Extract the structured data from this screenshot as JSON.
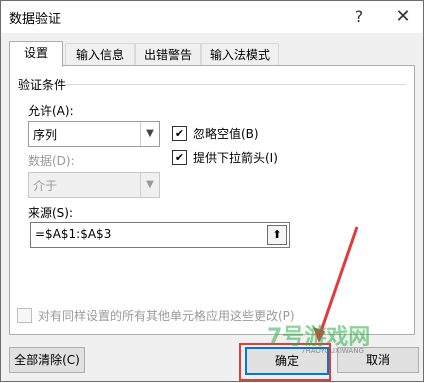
{
  "window": {
    "title": "数据验证",
    "help_label": "?",
    "close_label": "✕"
  },
  "tabs": [
    {
      "label": "设置",
      "active": true
    },
    {
      "label": "输入信息",
      "active": false
    },
    {
      "label": "出错警告",
      "active": false
    },
    {
      "label": "输入法模式",
      "active": false
    }
  ],
  "validation": {
    "group_label": "验证条件",
    "allow_label": "允许(A):",
    "allow_value": "序列",
    "data_label": "数据(D):",
    "data_value": "介于",
    "ignore_blank_label": "忽略空值(B)",
    "ignore_blank_checked": true,
    "dropdown_label": "提供下拉箭头(I)",
    "dropdown_checked": true,
    "source_label": "来源(S):",
    "source_value": "=$A$1:$A$3"
  },
  "apply_all_label": "对有同样设置的所有其他单元格应用这些更改(P)",
  "buttons": {
    "clear_all": "全部清除(C)",
    "ok": "确定",
    "cancel": "取消"
  },
  "watermark": {
    "text": "7号游戏网",
    "sub": "7HAOYOUXIWANG"
  },
  "colors": {
    "accent": "#0078d7",
    "highlight": "#e23b3b"
  }
}
